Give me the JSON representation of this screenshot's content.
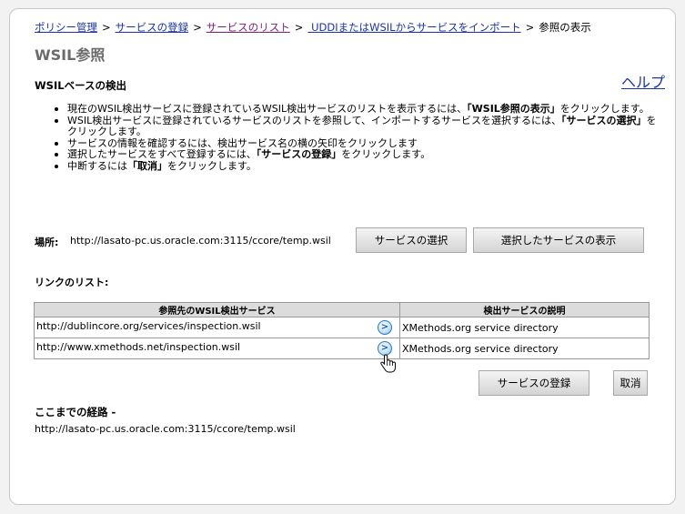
{
  "breadcrumb": {
    "items": [
      "ポリシー管理",
      "サービスの登録",
      "サービスのリスト",
      " UDDIまたはWSILからサービスをインポート"
    ],
    "separator": ">",
    "current": "参照の表示"
  },
  "page": {
    "title": "WSIL参照",
    "section_title": "WSILベースの検出",
    "help_link": "ヘルプ"
  },
  "instructions": [
    {
      "pre": "現在のWSIL検出サービスに登録されているWSIL検出サービスのリストを表示するには、",
      "bold": "「WSIL参照の表示」",
      "post": "をクリックします。"
    },
    {
      "pre": "WSIL検出サービスに登録されているサービスのリストを参照して、インポートするサービスを選択するには、",
      "bold": "「サービスの選択」",
      "post": "をクリックします。"
    },
    {
      "pre": "サービスの情報を確認するには、検出サービス名の横の矢印をクリックします",
      "bold": "",
      "post": ""
    },
    {
      "pre": "選択したサービスをすべて登録するには、",
      "bold": "「サービスの登録」",
      "post": "をクリックします。"
    },
    {
      "pre": "中断するには",
      "bold": "「取消」",
      "post": "をクリックします。"
    }
  ],
  "location": {
    "label": "場所:",
    "value": "http://lasato-pc.us.oracle.com:3115/ccore/temp.wsil"
  },
  "buttons": {
    "select_service": "サービスの選択",
    "show_selected": "選択したサービスの表示",
    "register": "サービスの登録",
    "cancel": "取消"
  },
  "links": {
    "label": "リンクのリスト:",
    "columns": [
      "参照先のWSIL検出サービス",
      "検出サービスの説明"
    ],
    "rows": [
      {
        "url": "http://dublincore.org/services/inspection.wsil",
        "description": "XMethods.org service directory"
      },
      {
        "url": "http://www.xmethods.net/inspection.wsil",
        "description": "XMethods.org service directory"
      }
    ],
    "arrow_icon": "arrow-right-circle-icon"
  },
  "route": {
    "label": "ここまでの経路 -",
    "value": "http://lasato-pc.us.oracle.com:3115/ccore/temp.wsil"
  }
}
